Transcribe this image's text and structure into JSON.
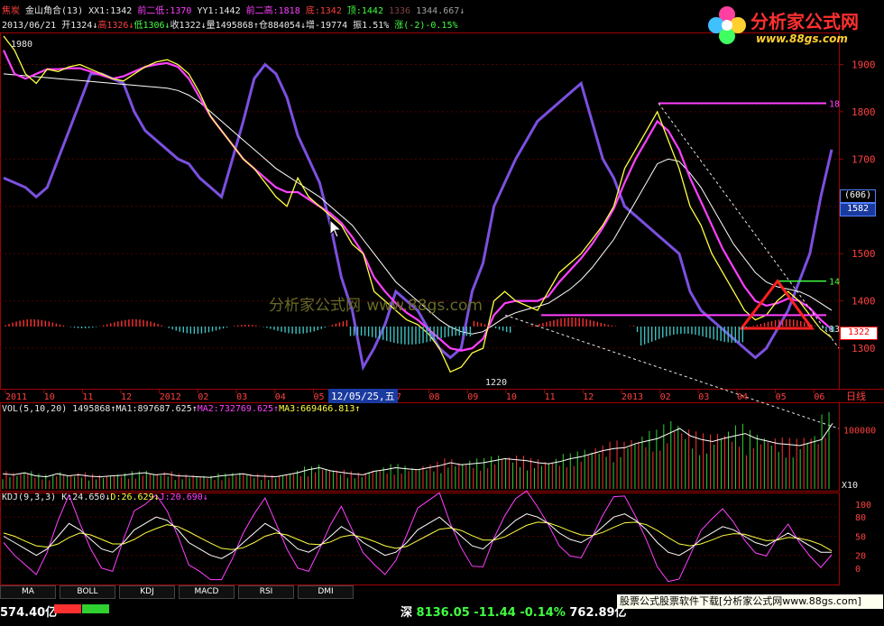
{
  "header": {
    "line1": [
      {
        "text": "焦炭",
        "color": "#ff4040"
      },
      {
        "text": "  金山角合(13) ",
        "color": "#e8e8e8"
      },
      {
        "text": "XX1:1342 ",
        "color": "#e8e8e8"
      },
      {
        "text": "前二低:1370 ",
        "color": "#ff40ff"
      },
      {
        "text": "YY1:1442 ",
        "color": "#e8e8e8"
      },
      {
        "text": "前二高:1818 ",
        "color": "#ff40ff"
      },
      {
        "text": "底:1342 ",
        "color": "#ff4040"
      },
      {
        "text": "顶:1442 ",
        "color": "#40ff40"
      },
      {
        "text": "1336 ",
        "color": "#804040"
      },
      {
        "text": "1344.667↓",
        "color": "#a0a0a0"
      }
    ],
    "line2": [
      {
        "text": "2013/06/21 ",
        "color": "#e8e8e8"
      },
      {
        "text": "开1324↓",
        "color": "#e8e8e8"
      },
      {
        "text": "高1326↓",
        "color": "#ff4040"
      },
      {
        "text": "低1306↓",
        "color": "#40ff40"
      },
      {
        "text": "收1322↓",
        "color": "#e8e8e8"
      },
      {
        "text": "量1495868↑",
        "color": "#e8e8e8"
      },
      {
        "text": "仓884054↓",
        "color": "#e8e8e8"
      },
      {
        "text": "增-19774 ",
        "color": "#e8e8e8"
      },
      {
        "text": "振1.51% ",
        "color": "#e8e8e8"
      },
      {
        "text": "涨(-2)-0.15%",
        "color": "#40ff40"
      }
    ]
  },
  "logo": {
    "title": "分析家公式网",
    "url": "www.88gs.com"
  },
  "watermark": {
    "text": "分析家公式网",
    "url": "www.88gs.com"
  },
  "price_tags": {
    "top": "(606)",
    "bottom": "1582",
    "current": "1322"
  },
  "date_cursor": "12/05/25,五",
  "axis_mode": "日线",
  "vol_header": [
    {
      "text": "VOL(5,10,20) 1495868↑",
      "color": "#e8e8e8"
    },
    {
      "text": "MA1:897687.625↑",
      "color": "#e8e8e8"
    },
    {
      "text": "MA2:732769.625↑",
      "color": "#ff40ff"
    },
    {
      "text": "MA3:669466.813↑",
      "color": "#ffff40"
    }
  ],
  "kdj_header": [
    {
      "text": "KDJ(9,3,3) ",
      "color": "#e8e8e8"
    },
    {
      "text": "K:24.650↓",
      "color": "#e8e8e8"
    },
    {
      "text": "D:26.629↓",
      "color": "#ffff40"
    },
    {
      "text": "J:20.690↓",
      "color": "#ff40ff"
    }
  ],
  "tabs": [
    "MA",
    "BOLL",
    "KDJ",
    "MACD",
    "RSI",
    "DMI"
  ],
  "status": {
    "left": "574.40亿",
    "market": "深",
    "index": "8136.05",
    "change": "-11.44",
    "pct": "-0.14%",
    "amount": "762.89亿"
  },
  "ad": "股票公式股票软件下载[分析家公式网www.88gs.com]",
  "colors": {
    "price": "#ffff40",
    "ma_mag": "#ff40ff",
    "ma_white": "#ffffff",
    "purple": "#7b50e0",
    "up": "#ff3030",
    "down": "#40c0c0",
    "axis": "#a00000"
  },
  "chart_data": [
    {
      "type": "line",
      "name": "price",
      "x_tick_labels": [
        "2011",
        "10",
        "11",
        "12",
        "2012",
        "02",
        "03",
        "04",
        "05",
        "06",
        "07",
        "08",
        "09",
        "10",
        "11",
        "12",
        "2013",
        "02",
        "03",
        "04",
        "05",
        "06"
      ],
      "y_ticks": [
        1300,
        1400,
        1500,
        1600,
        1700,
        1800,
        1900
      ],
      "ylim": [
        1220,
        1960
      ],
      "annotations": [
        {
          "label": "1980",
          "value": 1980
        },
        {
          "label": "1220",
          "value": 1220
        },
        {
          "label": "18",
          "value": 1818
        },
        {
          "label": "14",
          "value": 1442
        },
        {
          "label": "13",
          "value": 1342
        }
      ],
      "series": [
        {
          "values": [
            1960,
            1930,
            1880,
            1860,
            1890,
            1885,
            1895,
            1900,
            1890,
            1880,
            1870,
            1865,
            1880,
            1895,
            1905,
            1910,
            1900,
            1880,
            1840,
            1790,
            1760,
            1730,
            1700,
            1680,
            1650,
            1620,
            1600,
            1660,
            1620,
            1600,
            1580,
            1560,
            1520,
            1500,
            1420,
            1400,
            1380,
            1360,
            1350,
            1330,
            1300,
            1250,
            1260,
            1290,
            1300,
            1400,
            1420,
            1400,
            1390,
            1380,
            1420,
            1460,
            1480,
            1500,
            1530,
            1560,
            1600,
            1680,
            1720,
            1760,
            1800,
            1740,
            1680,
            1600,
            1560,
            1500,
            1460,
            1420,
            1380,
            1360,
            1370,
            1400,
            1420,
            1400,
            1370,
            1340,
            1322
          ]
        },
        {
          "values": [
            1930,
            1880,
            1870,
            1880,
            1890,
            1890,
            1892,
            1892,
            1885,
            1877,
            1870,
            1875,
            1885,
            1895,
            1900,
            1903,
            1895,
            1870,
            1830,
            1790,
            1760,
            1730,
            1700,
            1680,
            1660,
            1640,
            1630,
            1630,
            1615,
            1600,
            1585,
            1565,
            1535,
            1500,
            1450,
            1420,
            1395,
            1375,
            1360,
            1340,
            1320,
            1300,
            1295,
            1300,
            1320,
            1370,
            1395,
            1400,
            1400,
            1400,
            1410,
            1440,
            1465,
            1490,
            1520,
            1555,
            1595,
            1650,
            1700,
            1740,
            1780,
            1760,
            1720,
            1660,
            1610,
            1560,
            1510,
            1470,
            1430,
            1400,
            1390,
            1395,
            1405,
            1400,
            1385,
            1360,
            1340
          ]
        },
        {
          "values": [
            1880,
            1878,
            1876,
            1874,
            1872,
            1870,
            1868,
            1866,
            1864,
            1862,
            1860,
            1858,
            1856,
            1854,
            1852,
            1850,
            1845,
            1835,
            1820,
            1800,
            1780,
            1760,
            1740,
            1720,
            1700,
            1680,
            1665,
            1650,
            1635,
            1620,
            1600,
            1580,
            1560,
            1530,
            1500,
            1470,
            1440,
            1420,
            1400,
            1380,
            1360,
            1345,
            1335,
            1330,
            1335,
            1350,
            1365,
            1375,
            1382,
            1388,
            1395,
            1410,
            1425,
            1445,
            1470,
            1500,
            1530,
            1570,
            1610,
            1650,
            1690,
            1700,
            1695,
            1670,
            1640,
            1600,
            1560,
            1520,
            1490,
            1460,
            1440,
            1430,
            1425,
            1420,
            1410,
            1395,
            1380
          ]
        },
        {
          "values": [
            1660,
            1650,
            1640,
            1620,
            1640,
            1700,
            1760,
            1820,
            1880,
            1880,
            1870,
            1860,
            1800,
            1760,
            1740,
            1720,
            1700,
            1690,
            1660,
            1640,
            1620,
            1700,
            1780,
            1870,
            1900,
            1880,
            1830,
            1750,
            1700,
            1650,
            1560,
            1450,
            1380,
            1260,
            1300,
            1350,
            1420,
            1400,
            1380,
            1340,
            1300,
            1280,
            1300,
            1420,
            1480,
            1600,
            1650,
            1700,
            1740,
            1780,
            1800,
            1820,
            1840,
            1860,
            1780,
            1700,
            1660,
            1600,
            1580,
            1560,
            1540,
            1520,
            1500,
            1420,
            1380,
            1360,
            1340,
            1320,
            1300,
            1280,
            1300,
            1340,
            1380,
            1440,
            1500,
            1620,
            1720
          ]
        }
      ]
    },
    {
      "type": "bar",
      "name": "volume",
      "y_ticks": [
        100000
      ],
      "values": [
        300,
        280,
        320,
        260,
        240,
        300,
        260,
        280,
        250,
        240,
        260,
        270,
        300,
        320,
        280,
        300,
        260,
        250,
        240,
        230,
        260,
        280,
        300,
        260,
        250,
        240,
        280,
        320,
        380,
        420,
        360,
        330,
        300,
        280,
        350,
        380,
        420,
        400,
        380,
        420,
        460,
        520,
        480,
        500,
        520,
        560,
        600,
        580,
        560,
        520,
        500,
        540,
        600,
        640,
        700,
        760,
        800,
        820,
        900,
        950,
        1000,
        1100,
        1200,
        1050,
        980,
        940,
        1000,
        1050,
        1100,
        1000,
        950,
        900,
        880,
        860,
        920,
        980,
        1300
      ]
    },
    {
      "type": "line",
      "name": "kdj",
      "y_ticks": [
        0,
        20,
        50,
        80,
        100
      ],
      "ylim": [
        -20,
        110
      ],
      "series": [
        {
          "values": [
            50,
            40,
            30,
            20,
            30,
            50,
            70,
            60,
            45,
            30,
            25,
            40,
            60,
            70,
            80,
            75,
            60,
            40,
            30,
            20,
            15,
            25,
            40,
            55,
            70,
            60,
            45,
            30,
            25,
            35,
            50,
            65,
            55,
            40,
            30,
            20,
            25,
            40,
            60,
            70,
            80,
            65,
            50,
            35,
            30,
            45,
            60,
            75,
            85,
            80,
            70,
            55,
            45,
            40,
            50,
            65,
            80,
            85,
            75,
            60,
            40,
            25,
            20,
            30,
            45,
            55,
            65,
            60,
            50,
            40,
            35,
            45,
            55,
            45,
            35,
            25,
            25
          ]
        },
        {
          "values": [
            55,
            50,
            42,
            35,
            33,
            38,
            48,
            55,
            52,
            45,
            38,
            38,
            45,
            55,
            62,
            68,
            65,
            57,
            48,
            39,
            31,
            29,
            32,
            40,
            50,
            55,
            52,
            45,
            38,
            37,
            41,
            49,
            52,
            48,
            42,
            35,
            31,
            34,
            43,
            52,
            61,
            63,
            59,
            51,
            44,
            44,
            49,
            58,
            67,
            72,
            71,
            65,
            58,
            52,
            51,
            56,
            64,
            71,
            72,
            68,
            59,
            48,
            38,
            35,
            38,
            44,
            51,
            54,
            53,
            48,
            43,
            44,
            48,
            47,
            43,
            37,
            27
          ]
        },
        {
          "values": [
            40,
            20,
            5,
            -10,
            25,
            75,
            115,
            70,
            30,
            0,
            -5,
            45,
            90,
            100,
            115,
            90,
            50,
            5,
            -5,
            -18,
            -18,
            15,
            55,
            85,
            110,
            70,
            30,
            0,
            -5,
            30,
            68,
            97,
            60,
            24,
            6,
            -10,
            12,
            52,
            94,
            106,
            118,
            70,
            32,
            3,
            2,
            47,
            82,
            109,
            121,
            96,
            68,
            35,
            19,
            16,
            48,
            83,
            112,
            113,
            81,
            44,
            2,
            -21,
            -17,
            20,
            59,
            77,
            93,
            72,
            44,
            24,
            19,
            47,
            69,
            41,
            19,
            1,
            21
          ]
        }
      ]
    }
  ]
}
